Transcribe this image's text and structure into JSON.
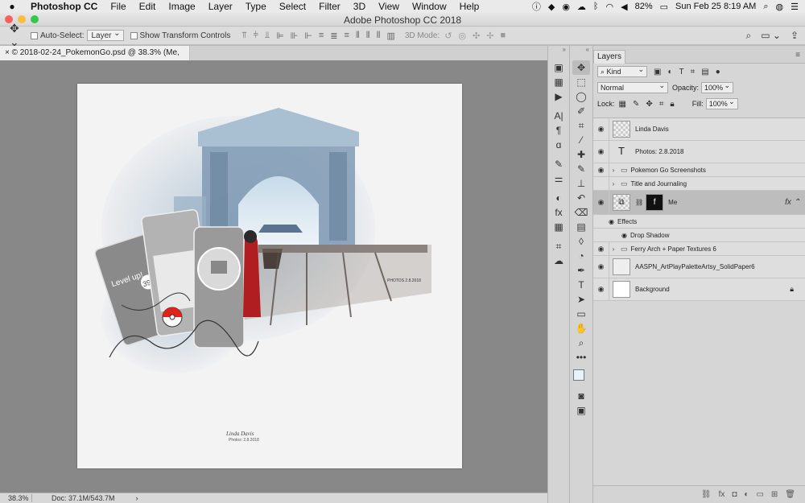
{
  "menubar": {
    "app": "Photoshop CC",
    "items": [
      "File",
      "Edit",
      "Image",
      "Layer",
      "Type",
      "Select",
      "Filter",
      "3D",
      "View",
      "Window",
      "Help"
    ],
    "battery": "82%",
    "datetime": "Sun Feb 25  8:19 AM"
  },
  "window": {
    "title": "Adobe Photoshop CC 2018"
  },
  "options": {
    "auto_select_label": "Auto-Select:",
    "auto_select_value": "Layer",
    "transform_label": "Show Transform Controls",
    "mode_3d_label": "3D Mode:"
  },
  "document": {
    "tab_title": "© 2018-02-24_PokemonGo.psd @ 38.3% (Me, RGB/8) *",
    "zoom": "38.3%",
    "doc_size": "Doc: 37.1M/543.7M",
    "artwork": {
      "signature_name": "Linda Davis",
      "signature_date": "Photos: 2.8.2018",
      "card_text": "Level up!",
      "card_number": "39"
    }
  },
  "layers_panel": {
    "tab": "Layers",
    "filter_kind": "Kind",
    "blend_mode": "Normal",
    "opacity_label": "Opacity:",
    "opacity_value": "100%",
    "lock_label": "Lock:",
    "fill_label": "Fill:",
    "fill_value": "100%",
    "layers": [
      {
        "name": "Linda Davis",
        "kind": "pixel"
      },
      {
        "name": "Photos: 2.8.2018",
        "kind": "text"
      },
      {
        "name": "Pokemon Go Screenshots",
        "kind": "group"
      },
      {
        "name": "Title and Journaling",
        "kind": "group"
      },
      {
        "name": "Me",
        "kind": "smart"
      },
      {
        "name": "Effects",
        "kind": "effects"
      },
      {
        "name": "Drop Shadow",
        "kind": "effect"
      },
      {
        "name": "Ferry Arch + Paper Textures 6",
        "kind": "group"
      },
      {
        "name": "AASPN_ArtPlayPaletteArtsy_SolidPaper6",
        "kind": "pixel"
      },
      {
        "name": "Background",
        "kind": "background"
      }
    ]
  },
  "colors": {
    "menubar": "#eaeaea",
    "canvas_bg": "#888888",
    "selected_layer": "#bdbdbd"
  }
}
